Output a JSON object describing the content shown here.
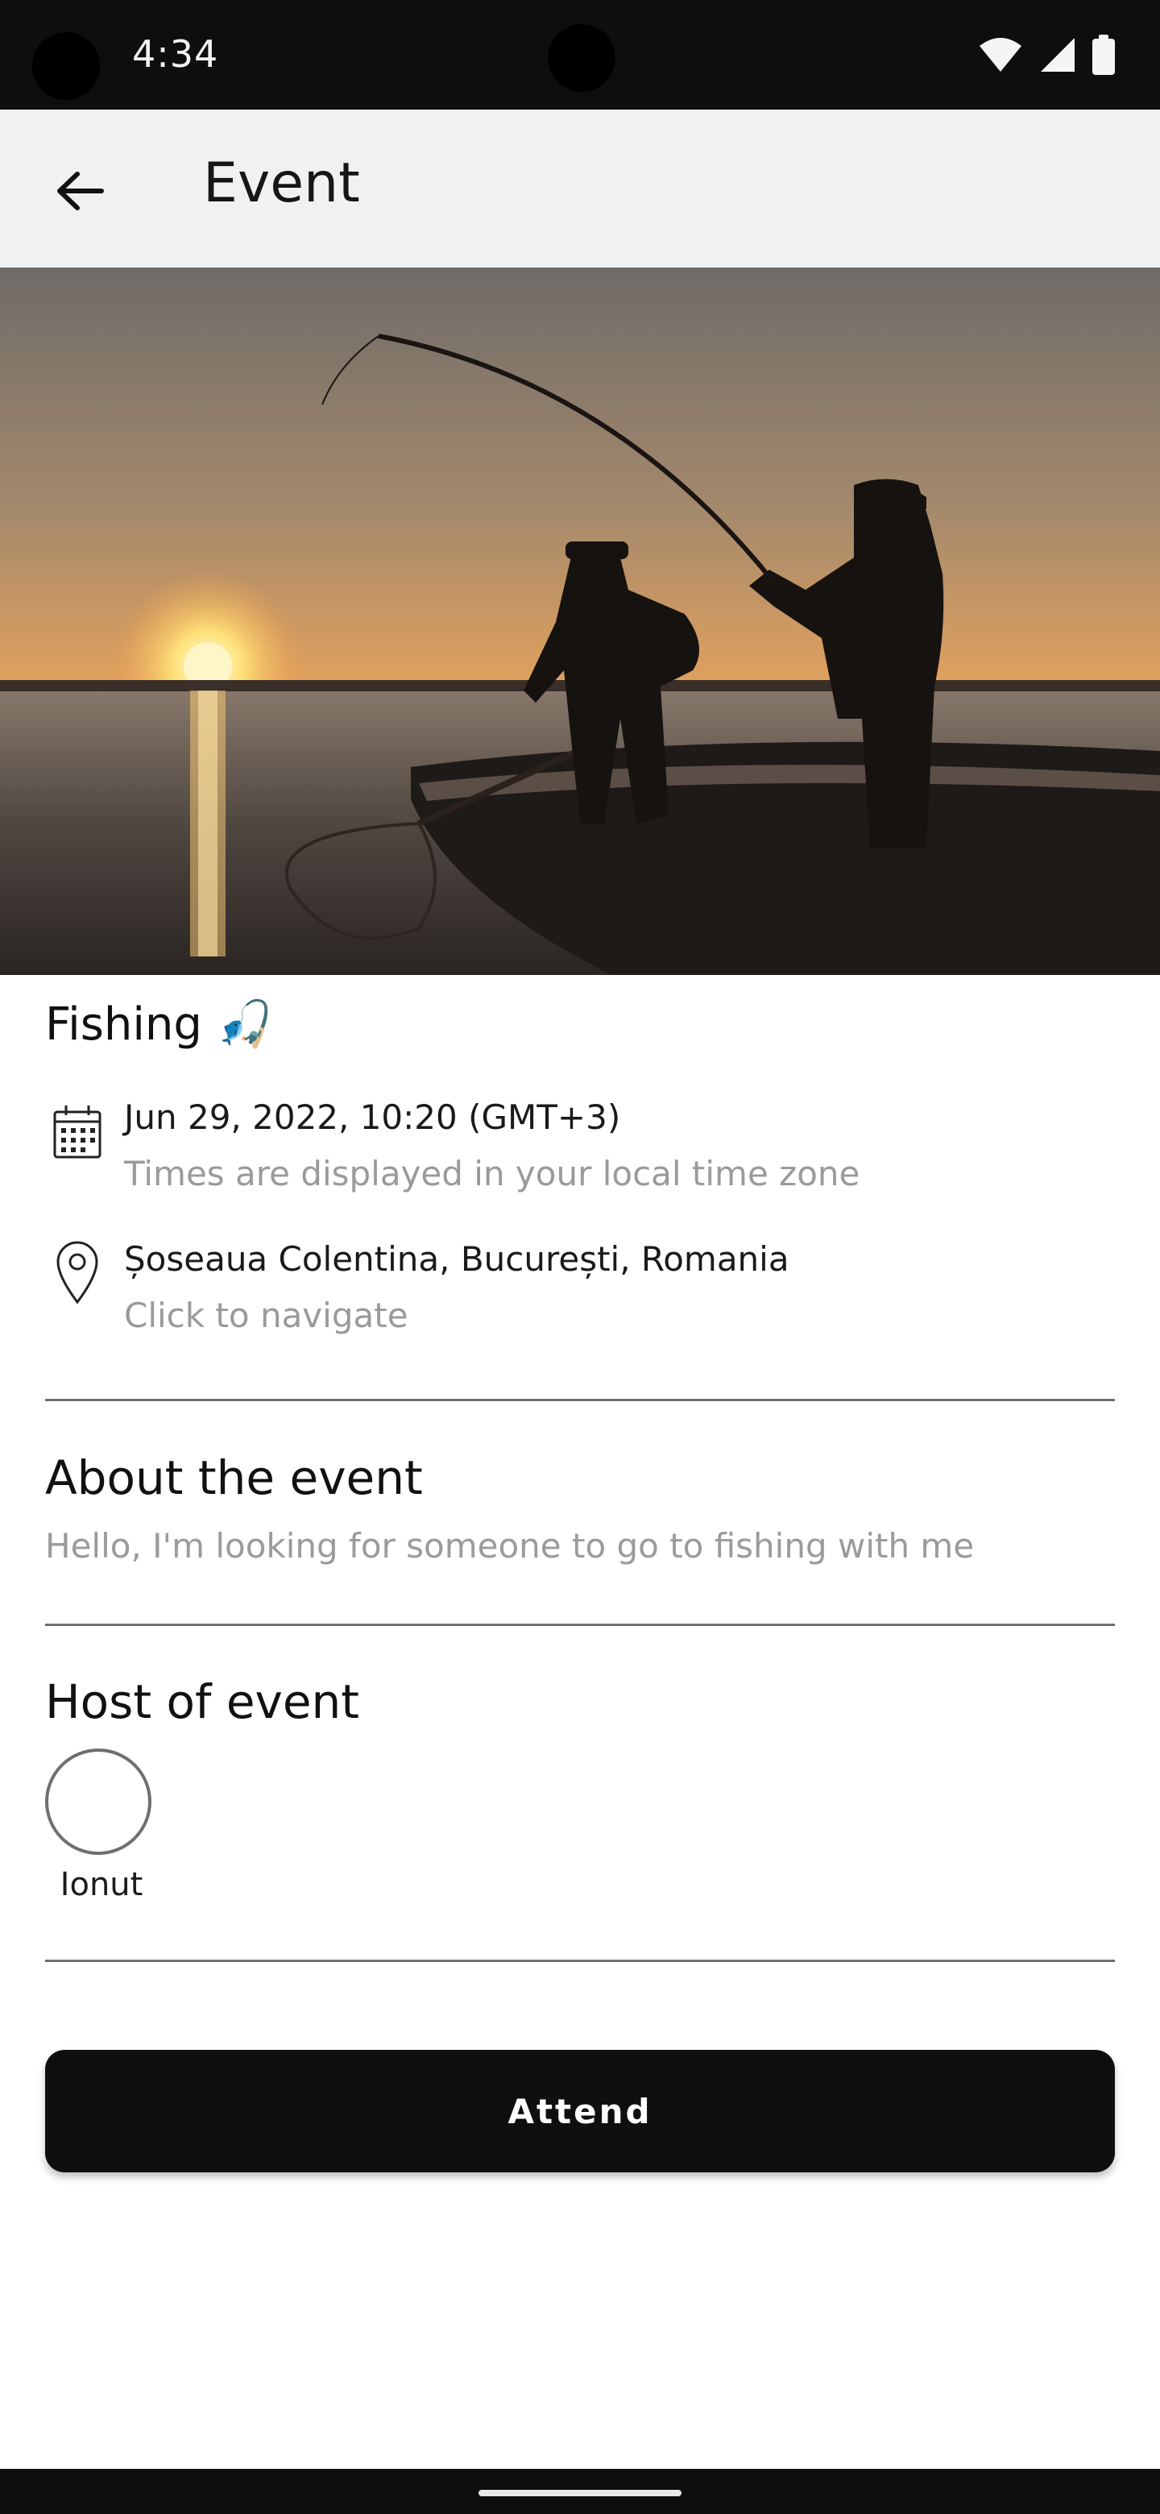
{
  "status_bar": {
    "time": "4:34",
    "icons": [
      "wifi-icon",
      "cell-signal-icon",
      "battery-icon"
    ]
  },
  "app_bar": {
    "title": "Event",
    "back_icon": "arrow-back-icon"
  },
  "event": {
    "title": "Fishing",
    "title_emoji": "🎣",
    "datetime": "Jun 29, 2022, 10:20 (GMT+3)",
    "timezone_note": "Times are displayed in your local time zone",
    "location": "Șoseaua Colentina, București, Romania",
    "location_hint": "Click to navigate"
  },
  "about": {
    "heading": "About the event",
    "text": "Hello, I'm looking for someone to go to fishing with me"
  },
  "host": {
    "heading": "Host of event",
    "name": "Ionut"
  },
  "actions": {
    "attend_label": "Attend"
  },
  "colors": {
    "status_bar": "#0e0e0e",
    "app_bar": "#f0f1f3",
    "button": "#0f0f0f",
    "muted_text": "#9a9a9a",
    "divider": "#6f6f6f"
  }
}
